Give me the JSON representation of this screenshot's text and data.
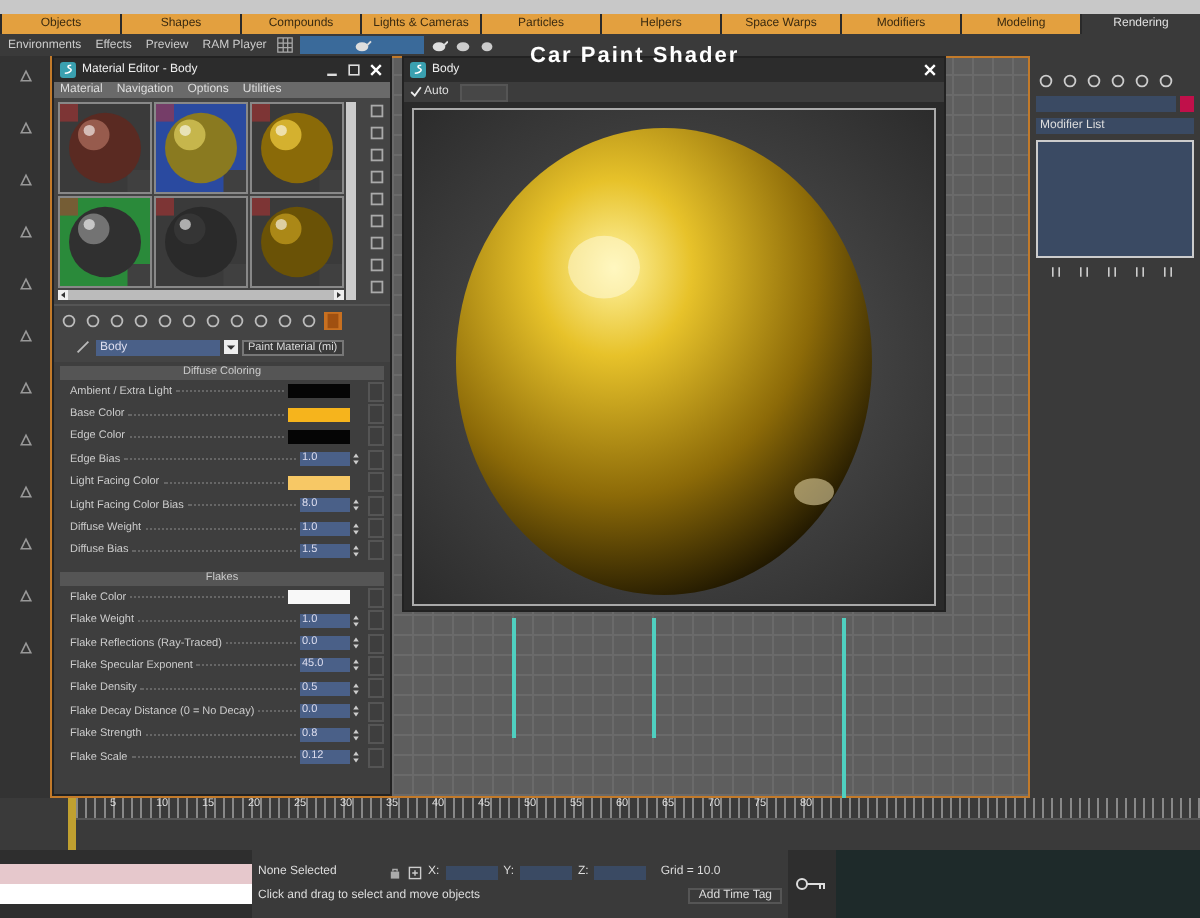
{
  "tabs": [
    {
      "label": "Objects",
      "selected": false
    },
    {
      "label": "Shapes",
      "selected": false
    },
    {
      "label": "Compounds",
      "selected": false
    },
    {
      "label": "Lights & Cameras",
      "selected": false
    },
    {
      "label": "Particles",
      "selected": false
    },
    {
      "label": "Helpers",
      "selected": false
    },
    {
      "label": "Space Warps",
      "selected": false
    },
    {
      "label": "Modifiers",
      "selected": false
    },
    {
      "label": "Modeling",
      "selected": false
    },
    {
      "label": "Rendering",
      "selected": true
    }
  ],
  "toolbar": [
    "Environments",
    "Effects",
    "Preview",
    "RAM Player"
  ],
  "overlay_title": "Car Paint Shader",
  "material_editor": {
    "title": "Material Editor - Body",
    "menu": [
      "Material",
      "Navigation",
      "Options",
      "Utilities"
    ],
    "name": "Body",
    "material_type": "Paint Material (mi)",
    "sections": [
      {
        "title": "Diffuse Coloring",
        "rows": [
          {
            "label": "Ambient / Extra Light",
            "kind": "color",
            "color": "#050505"
          },
          {
            "label": "Base Color",
            "kind": "color",
            "color": "#f6b41c"
          },
          {
            "label": "Edge Color",
            "kind": "color",
            "color": "#050505"
          },
          {
            "label": "Edge Bias",
            "kind": "spinner",
            "value": "1.0"
          },
          {
            "label": "Light Facing Color",
            "kind": "color",
            "color": "#f7c865"
          },
          {
            "label": "Light Facing Color Bias",
            "kind": "spinner",
            "value": "8.0"
          },
          {
            "label": "Diffuse Weight",
            "kind": "spinner",
            "value": "1.0"
          },
          {
            "label": "Diffuse Bias",
            "kind": "spinner",
            "value": "1.5"
          }
        ]
      },
      {
        "title": "Flakes",
        "rows": [
          {
            "label": "Flake Color",
            "kind": "color",
            "color": "#f8f8f8"
          },
          {
            "label": "Flake Weight",
            "kind": "spinner",
            "value": "1.0"
          },
          {
            "label": "Flake Reflections (Ray-Traced)",
            "kind": "spinner",
            "value": "0.0"
          },
          {
            "label": "Flake Specular Exponent",
            "kind": "spinner",
            "value": "45.0"
          },
          {
            "label": "Flake Density",
            "kind": "spinner",
            "value": "0.5"
          },
          {
            "label": "Flake Decay Distance (0 = No Decay)",
            "kind": "spinner",
            "value": "0.0"
          },
          {
            "label": "Flake Strength",
            "kind": "spinner",
            "value": "0.8"
          },
          {
            "label": "Flake Scale",
            "kind": "spinner",
            "value": "0.12"
          }
        ]
      }
    ]
  },
  "render_window": {
    "title": "Body",
    "auto": {
      "label": "Auto",
      "checked": true
    }
  },
  "command_panel": {
    "modifier_list": "Modifier List"
  },
  "timeline": {
    "ticks": [
      "5",
      "10",
      "15",
      "20",
      "25",
      "30",
      "35",
      "40",
      "45",
      "50",
      "55",
      "60",
      "65",
      "70",
      "75",
      "80"
    ]
  },
  "status_bar": {
    "selection": "None Selected",
    "x_label": "X:",
    "y_label": "Y:",
    "z_label": "Z:",
    "grid": "Grid = 10.0",
    "prompt": "Click and drag to select and move objects",
    "time_tag": "Add Time Tag"
  }
}
